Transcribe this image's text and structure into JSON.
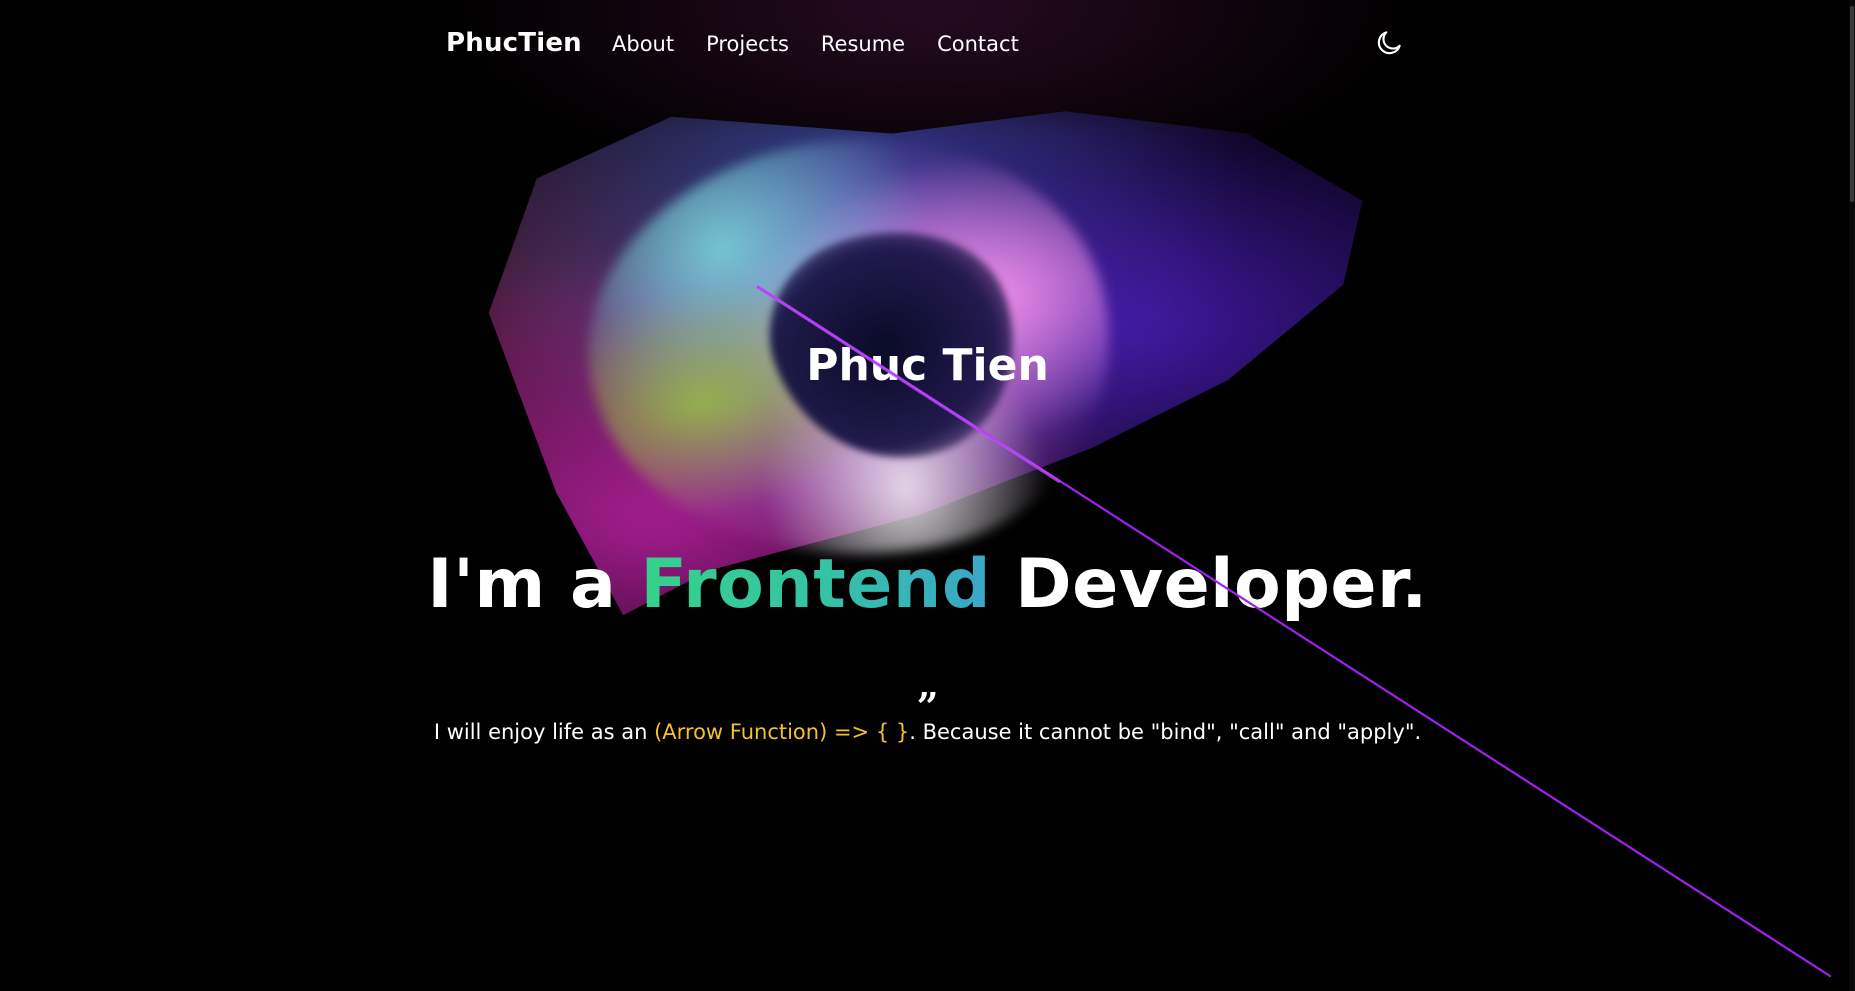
{
  "header": {
    "logo": "PhucTien",
    "nav_items": [
      {
        "label": "About"
      },
      {
        "label": "Projects"
      },
      {
        "label": "Resume"
      },
      {
        "label": "Contact"
      }
    ],
    "theme_toggle_icon": "moon-icon"
  },
  "hero": {
    "name": "Phuc Tien",
    "headline_prefix": "I'm a ",
    "headline_accent": "Frontend",
    "headline_suffix": " Developer.",
    "quote_mark": "”",
    "quote_prefix": "I will enjoy life as an ",
    "quote_code": "(Arrow Function) => { }",
    "quote_suffix": ". Because it cannot be \"bind\", \"call\" and \"apply\"."
  },
  "colors": {
    "background": "#000000",
    "accent_gradient_start": "#37d08a",
    "accent_gradient_end": "#3aa6c8",
    "code_highlight": "#f2c12e",
    "beam": "#a020f0"
  }
}
